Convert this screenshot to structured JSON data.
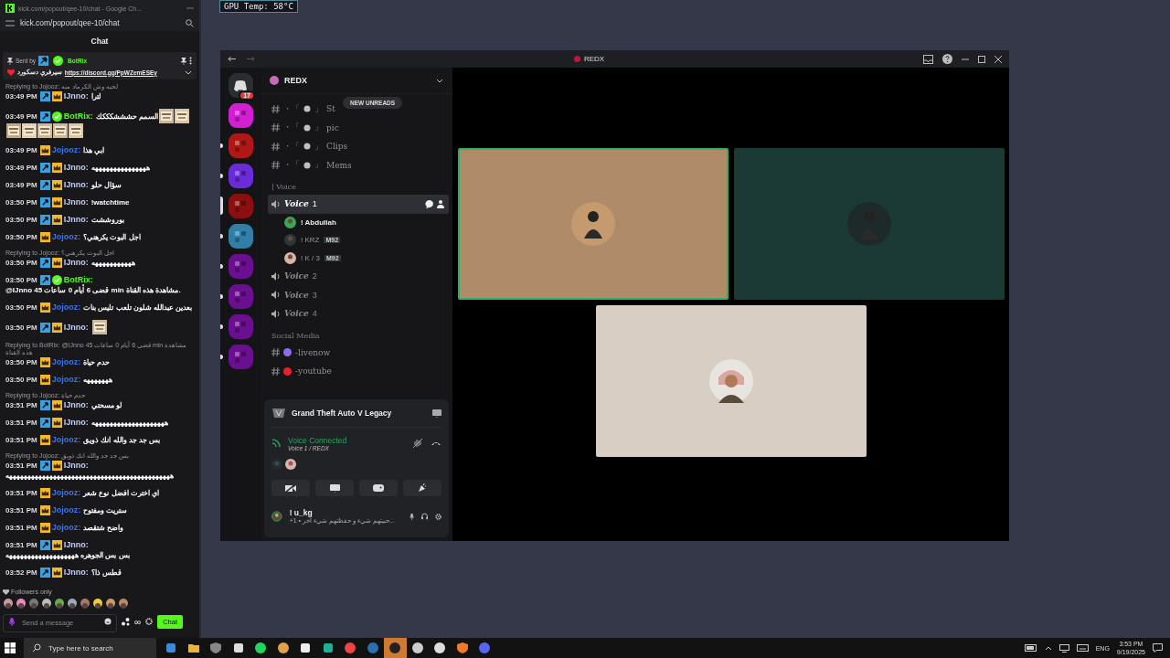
{
  "browser": {
    "title": "kick.com/popout/qee-10/chat - Google Ch...",
    "url": "kick.com/popout/qee-10/chat"
  },
  "chat": {
    "title": "Chat",
    "pinned": {
      "label": "Sent by",
      "author": "BotRix",
      "text": "سيرفري دسكورد",
      "link": "https://discord.gg/PpWZemESEy"
    },
    "messages": [
      {
        "reply": "Replying to Jojooz: لحيه وش الكرماد منه",
        "time": "03:49 PM",
        "badges": [
          {
            "kind": "mod"
          },
          {
            "kind": "sub"
          }
        ],
        "user": "IJnno:",
        "color": "#c3cdf5",
        "text": "لترا"
      },
      {
        "time": "03:49 PM",
        "badges": [
          {
            "kind": "mod"
          },
          {
            "kind": "verified"
          }
        ],
        "user": "BotRix:",
        "color": "#53fc18",
        "text": "السمم حشششكككك",
        "emotes": [
          {
            "kind": "picture"
          },
          {
            "kind": "picture"
          },
          {
            "kind": "picture"
          },
          {
            "kind": "picture"
          },
          {
            "kind": "picture"
          },
          {
            "kind": "picture"
          },
          {
            "kind": "picture"
          }
        ]
      },
      {
        "time": "03:49 PM",
        "badges": [
          {
            "kind": "sub"
          }
        ],
        "user": "Jojooz:",
        "color": "#3f74e6",
        "text": "ابي هذا"
      },
      {
        "time": "03:49 PM",
        "badges": [
          {
            "kind": "mod"
          },
          {
            "kind": "sub"
          }
        ],
        "user": "IJnno:",
        "color": "#c3cdf5",
        "text": "هههههههههههههههه"
      },
      {
        "time": "03:49 PM",
        "badges": [
          {
            "kind": "mod"
          },
          {
            "kind": "sub"
          }
        ],
        "user": "IJnno:",
        "color": "#c3cdf5",
        "text": "سؤال حلو"
      },
      {
        "time": "03:50 PM",
        "badges": [
          {
            "kind": "mod"
          },
          {
            "kind": "sub"
          }
        ],
        "user": "IJnno:",
        "color": "#c3cdf5",
        "text": "!watchtime"
      },
      {
        "time": "03:50 PM",
        "badges": [
          {
            "kind": "mod"
          },
          {
            "kind": "sub"
          }
        ],
        "user": "IJnno:",
        "color": "#c3cdf5",
        "text": "بوروششت"
      },
      {
        "time": "03:50 PM",
        "badges": [
          {
            "kind": "sub"
          }
        ],
        "user": "Jojooz:",
        "color": "#3f74e6",
        "text": "اجل البوت يكرهني؟"
      },
      {
        "reply": "Replying to Jojooz: اجل البوت يكرهني؟",
        "time": "03:50 PM",
        "badges": [
          {
            "kind": "mod"
          },
          {
            "kind": "sub"
          }
        ],
        "user": "IJnno:",
        "color": "#c3cdf5",
        "text": "هههههههههههه"
      },
      {
        "time": "03:50 PM",
        "badges": [
          {
            "kind": "mod"
          },
          {
            "kind": "verified"
          }
        ],
        "user": "BotRix:",
        "color": "#53fc18",
        "text": "@IJnno قضى 6 أيام 0 ساعات 45 min مشاهدة هذه القناة."
      },
      {
        "time": "03:50 PM",
        "badges": [
          {
            "kind": "sub"
          }
        ],
        "user": "Jojooz:",
        "color": "#3f74e6",
        "text": "بعدين عبدالله شلون تلعب تليس بنات"
      },
      {
        "time": "03:50 PM",
        "badges": [
          {
            "kind": "mod"
          },
          {
            "kind": "sub"
          }
        ],
        "user": "IJnno:",
        "color": "#c3cdf5",
        "emotes": [
          {
            "kind": "picture"
          }
        ]
      },
      {
        "reply": "Replying to BotRix: @IJnno 45 قضى 6 أيام 0 ساعات min مشاهدة هذه القناة",
        "time": "03:50 PM",
        "badges": [
          {
            "kind": "sub"
          }
        ],
        "user": "Jojooz:",
        "color": "#3f74e6",
        "text": "حدم حياة"
      },
      {
        "time": "03:50 PM",
        "badges": [
          {
            "kind": "sub"
          }
        ],
        "user": "Jojooz:",
        "color": "#3f74e6",
        "text": "هههههههه"
      },
      {
        "reply": "Replying to Jojooz: حدم حياة",
        "time": "03:51 PM",
        "badges": [
          {
            "kind": "mod"
          },
          {
            "kind": "sub"
          }
        ],
        "user": "IJnno:",
        "color": "#c3cdf5",
        "text": "لو مسحتي"
      },
      {
        "time": "03:51 PM",
        "badges": [
          {
            "kind": "mod"
          },
          {
            "kind": "sub"
          }
        ],
        "user": "IJnno:",
        "color": "#c3cdf5",
        "text": "ههههههههههههههههههههه"
      },
      {
        "time": "03:51 PM",
        "badges": [
          {
            "kind": "sub"
          }
        ],
        "user": "Jojooz:",
        "color": "#3f74e6",
        "text": "بس جد جد والله انك ذويق"
      },
      {
        "reply": "Replying to Jojooz: بس جد جد والله انك ذويق",
        "time": "03:51 PM",
        "badges": [
          {
            "kind": "mod"
          },
          {
            "kind": "sub"
          }
        ],
        "user": "IJnno:",
        "color": "#c3cdf5",
        "text": "هههههههههههههههههههههههههههههههههههههههههههههه"
      },
      {
        "time": "03:51 PM",
        "badges": [
          {
            "kind": "sub"
          }
        ],
        "user": "Jojooz:",
        "color": "#3f74e6",
        "text": "اي اخترت افضل نوع شعر"
      },
      {
        "time": "03:51 PM",
        "badges": [
          {
            "kind": "sub"
          }
        ],
        "user": "Jojooz:",
        "color": "#3f74e6",
        "text": "ستريت ومفتوح"
      },
      {
        "time": "03:51 PM",
        "badges": [
          {
            "kind": "sub"
          }
        ],
        "user": "Jojooz:",
        "color": "#3f74e6",
        "text": "واضح شتقصد"
      },
      {
        "time": "03:51 PM",
        "badges": [
          {
            "kind": "mod"
          },
          {
            "kind": "sub"
          }
        ],
        "user": "IJnno:",
        "color": "#c3cdf5",
        "text": "بس بس الجوهره هههههههههههههههههههه"
      },
      {
        "time": "03:52 PM",
        "badges": [
          {
            "kind": "mod"
          },
          {
            "kind": "sub"
          }
        ],
        "user": "IJnno:",
        "color": "#c3cdf5",
        "text": "قطس ذا؟"
      }
    ],
    "followers": "Followers only",
    "emote_bar": [
      {
        "kind": "picture"
      },
      {
        "kind": "picture"
      },
      {
        "kind": "picture"
      },
      {
        "kind": "picture"
      },
      {
        "kind": "picture"
      },
      {
        "kind": "picture"
      },
      {
        "kind": "picture"
      },
      {
        "kind": "picture"
      },
      {
        "kind": "picture"
      },
      {
        "kind": "picture"
      }
    ],
    "input": {
      "placeholder": "Send a message"
    },
    "infinity": "∞",
    "send": "Chat"
  },
  "overlay": {
    "gpu": "GPU Temp: 58°C"
  },
  "discord": {
    "title": "REDX",
    "badge": "17",
    "servers": [
      {
        "color": "#2b2d31",
        "unread": false
      },
      {
        "color": "#d21fd2",
        "unread": false
      },
      {
        "color": "#b01818",
        "unread": true
      },
      {
        "color": "#6a2bd9",
        "unread": true
      },
      {
        "color": "#8b0f0f",
        "unread": false,
        "selected": true
      },
      {
        "color": "#2f7fa8",
        "unread": true
      },
      {
        "color": "#6a0f8f",
        "unread": true
      },
      {
        "color": "#6a0f8f",
        "unread": true
      },
      {
        "color": "#6a0f8f",
        "unread": true
      },
      {
        "color": "#6a0f8f",
        "unread": true
      }
    ],
    "server_name": "REDX",
    "new_unreads": "NEW UNREADS",
    "channels": [
      {
        "kind": "text",
        "pre": "・「",
        "post": "」",
        "name": "St"
      },
      {
        "kind": "text",
        "pre": "・「",
        "post": "」",
        "name": "pic"
      },
      {
        "kind": "text",
        "pre": "・「",
        "post": "」",
        "name": "Clips"
      },
      {
        "kind": "text",
        "pre": "・「",
        "post": "」",
        "name": "Mems"
      },
      {
        "kind": "category",
        "name": "| Voice"
      },
      {
        "kind": "voice",
        "name": "Voice",
        "number": "1",
        "selected": true,
        "members": [
          {
            "name": "! Abdullah"
          },
          {
            "name": "! KRZ",
            "tag": "M92"
          },
          {
            "name": "! K / 3",
            "tag": "M92"
          }
        ]
      },
      {
        "kind": "voice",
        "name": "Voice",
        "number": "2",
        "selected": false
      },
      {
        "kind": "voice",
        "name": "Voice",
        "number": "3",
        "selected": false
      },
      {
        "kind": "voice",
        "name": "Voice",
        "number": "4",
        "selected": false
      },
      {
        "kind": "category",
        "name": "Social Media"
      },
      {
        "kind": "feed",
        "name": "-livenow",
        "color": "#8b6cf2"
      },
      {
        "kind": "feed",
        "name": "-youtube",
        "color": "#e8202a"
      }
    ],
    "activity": "Grand Theft Auto V Legacy",
    "voice_status": "Voice Connected",
    "voice_channel": "Voice 1 / REDX",
    "user": {
      "name": "! u_kg",
      "status": "+1 • حبيتهم شيء و حفظتهم شيء آخر..."
    },
    "tiles": [
      {
        "color": "#b08b6a",
        "speaking": true
      },
      {
        "color": "#1b3a36",
        "speaking": false
      },
      {
        "color": "#d8cec4",
        "speaking": false
      }
    ]
  },
  "taskbar": {
    "search": "Type here to search",
    "apps": [
      {
        "kind": "store",
        "selected": false
      },
      {
        "kind": "folder",
        "selected": false
      },
      {
        "kind": "shield",
        "selected": false
      },
      {
        "kind": "editor",
        "selected": false
      },
      {
        "kind": "music",
        "selected": false
      },
      {
        "kind": "person",
        "selected": false
      },
      {
        "kind": "file",
        "selected": false
      },
      {
        "kind": "app",
        "selected": false
      },
      {
        "kind": "browser",
        "selected": false
      },
      {
        "kind": "steam",
        "selected": false
      },
      {
        "kind": "record",
        "selected": true
      },
      {
        "kind": "wheel",
        "selected": false
      },
      {
        "kind": "logi",
        "selected": false
      },
      {
        "kind": "fl",
        "selected": false
      },
      {
        "kind": "discord",
        "selected": false
      }
    ],
    "lang": "ENG",
    "time": "3:53 PM",
    "date": "9/19/2025"
  }
}
